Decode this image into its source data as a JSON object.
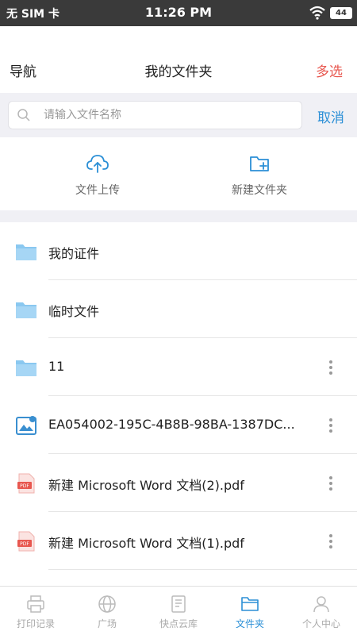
{
  "status_bar": {
    "carrier": "无 SIM 卡",
    "time": "11:26 PM",
    "battery": "44"
  },
  "nav": {
    "left": "导航",
    "title": "我的文件夹",
    "right": "多选"
  },
  "search": {
    "placeholder": "请输入文件名称",
    "cancel": "取消"
  },
  "actions": {
    "upload": "文件上传",
    "new_folder": "新建文件夹"
  },
  "files": [
    {
      "name": "我的证件",
      "icon": "folder-icon",
      "has_more": false
    },
    {
      "name": "临时文件",
      "icon": "folder-icon",
      "has_more": false
    },
    {
      "name": "11",
      "icon": "folder-icon",
      "has_more": true
    },
    {
      "name": "EA054002-195C-4B8B-98BA-1387DC...",
      "icon": "image-file-icon",
      "has_more": true
    },
    {
      "name": "新建 Microsoft Word 文档(2).pdf",
      "icon": "pdf-file-icon",
      "has_more": true
    },
    {
      "name": "新建 Microsoft Word 文档(1).pdf",
      "icon": "pdf-file-icon",
      "has_more": true
    }
  ],
  "tabs": [
    {
      "label": "打印记录",
      "icon": "printer-icon",
      "active": false
    },
    {
      "label": "广场",
      "icon": "globe-icon",
      "active": false
    },
    {
      "label": "快点云库",
      "icon": "document-icon",
      "active": false
    },
    {
      "label": "文件夹",
      "icon": "folder-icon",
      "active": true
    },
    {
      "label": "个人中心",
      "icon": "person-icon",
      "active": false
    }
  ],
  "colors": {
    "accent": "#2b8fd6",
    "danger": "#e8574f",
    "folder": "#8ac8f0",
    "pdf": "#e8574f",
    "inactive": "#aaaaaa"
  }
}
